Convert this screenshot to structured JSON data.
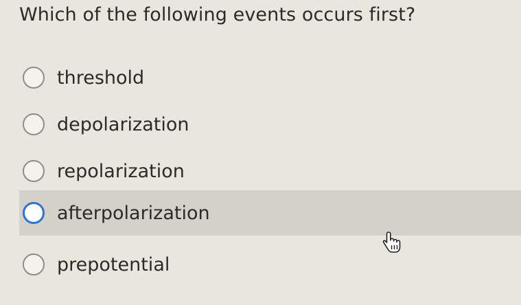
{
  "question": {
    "text": "Which of the following events occurs first?"
  },
  "options": [
    {
      "label": "threshold",
      "selected": false,
      "hovered": false
    },
    {
      "label": "depolarization",
      "selected": false,
      "hovered": false
    },
    {
      "label": "repolarization",
      "selected": false,
      "hovered": false
    },
    {
      "label": "afterpolarization",
      "selected": false,
      "hovered": true
    },
    {
      "label": "prepotential",
      "selected": false,
      "hovered": false
    }
  ],
  "cursor": {
    "icon": "hand-pointer-icon"
  },
  "colors": {
    "background": "#e9e6de",
    "hover_row": "#d4d1c9",
    "radio_focus": "#2a74d9",
    "text": "#2a2a28"
  }
}
